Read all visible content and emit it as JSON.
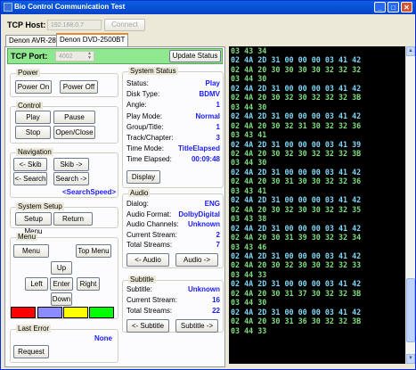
{
  "window": {
    "title": "Bio Control Communication Test",
    "min": "_",
    "max": "□",
    "close": "✕"
  },
  "tcp_host": {
    "label": "TCP Host:",
    "value": "192.168.0.7",
    "connect": "Connect"
  },
  "tabs": [
    "Denon AVR-2808",
    "Denon DVD-2500BT"
  ],
  "tcp_port": {
    "label": "TCP Port:",
    "value": "4002",
    "update": "Update Status"
  },
  "power": {
    "title": "Power",
    "on": "Power On",
    "off": "Power Off"
  },
  "control": {
    "title": "Control",
    "play": "Play",
    "pause": "Pause",
    "stop": "Stop",
    "open_close": "Open/Close"
  },
  "navigation": {
    "title": "Navigation",
    "skip_back": "<- Skib",
    "skip_fwd": "Skib ->",
    "search_back": "<- Search",
    "search_fwd": "Search ->",
    "search_speed": "<SearchSpeed>"
  },
  "system_setup": {
    "title": "System Setup",
    "setup_menu": "Setup Menu",
    "return": "Return"
  },
  "menu": {
    "title": "Menu",
    "menu": "Menu",
    "top_menu": "Top Menu",
    "up": "Up",
    "left": "Left",
    "enter": "Enter",
    "right": "Right",
    "down": "Down",
    "colors": [
      "#ff0000",
      "#8a8cff",
      "#ffff00",
      "#00ff00"
    ]
  },
  "last_error": {
    "title": "Last Error",
    "value": "None",
    "request": "Request"
  },
  "status": {
    "title": "System Status",
    "rows": [
      {
        "label": "Status:",
        "value": "Play"
      },
      {
        "label": "Disk Type:",
        "value": "BDMV"
      },
      {
        "label": "Angle:",
        "value": "1"
      },
      {
        "label": "Play Mode:",
        "value": "Normal"
      },
      {
        "label": "Group/Title:",
        "value": "1"
      },
      {
        "label": "Track/Chapter:",
        "value": "3"
      },
      {
        "label": "Time Mode:",
        "value": "TitleElapsed"
      },
      {
        "label": "Time Elapsed:",
        "value": "00:09:48"
      }
    ],
    "display": "Display"
  },
  "audio": {
    "title": "Audio",
    "rows": [
      {
        "label": "Dialog:",
        "value": "ENG"
      },
      {
        "label": "Audio Format:",
        "value": "DolbyDigital"
      },
      {
        "label": "Audio Channels:",
        "value": "Unknown"
      },
      {
        "label": "Current Stream:",
        "value": "2"
      },
      {
        "label": "Total Streams:",
        "value": "7"
      }
    ],
    "prev": "<- Audio",
    "next": "Audio ->"
  },
  "subtitle": {
    "title": "Subtitle",
    "rows": [
      {
        "label": "Subtitle:",
        "value": "Unknown"
      },
      {
        "label": "Current Stream:",
        "value": "16"
      },
      {
        "label": "Total Streams:",
        "value": "22"
      }
    ],
    "prev": "<- Subtitle",
    "next": "Subtitle ->"
  },
  "terminal": {
    "colors": {
      "rx": "#7fd7f5",
      "tx": "#7fdc7f"
    },
    "lines": [
      {
        "t": "03 43 34",
        "c": "tx"
      },
      {
        "t": "02 4A 2D 31 00 00 00 03 41 42",
        "c": "rx"
      },
      {
        "t": "02 4A 20 30 30 30 30 32 32 32",
        "c": "tx"
      },
      {
        "t": "03 44 30",
        "c": "tx"
      },
      {
        "t": "02 4A 2D 31 00 00 00 03 41 42",
        "c": "rx"
      },
      {
        "t": "02 4A 20 30 32 30 32 32 32 3B",
        "c": "tx"
      },
      {
        "t": "03 44 30",
        "c": "tx"
      },
      {
        "t": "02 4A 2D 31 00 00 00 03 41 42",
        "c": "rx"
      },
      {
        "t": "02 4A 20 30 32 31 30 32 32 36",
        "c": "tx"
      },
      {
        "t": "03 43 41",
        "c": "tx"
      },
      {
        "t": "02 4A 2D 31 00 00 00 03 41 39",
        "c": "rx"
      },
      {
        "t": "02 4A 20 30 32 30 32 32 32 3B",
        "c": "tx"
      },
      {
        "t": "03 44 30",
        "c": "tx"
      },
      {
        "t": "02 4A 2D 31 00 00 00 03 41 42",
        "c": "rx"
      },
      {
        "t": "02 4A 20 30 31 30 30 32 32 36",
        "c": "tx"
      },
      {
        "t": "03 43 41",
        "c": "tx"
      },
      {
        "t": "02 4A 2D 31 00 00 00 03 41 42",
        "c": "rx"
      },
      {
        "t": "02 4A 20 30 32 30 30 32 32 35",
        "c": "tx"
      },
      {
        "t": "03 43 38",
        "c": "tx"
      },
      {
        "t": "02 4A 2D 31 00 00 00 03 41 42",
        "c": "rx"
      },
      {
        "t": "02 4A 20 30 31 39 30 32 32 34",
        "c": "tx"
      },
      {
        "t": "03 43 46",
        "c": "tx"
      },
      {
        "t": "02 4A 2D 31 00 00 00 03 41 42",
        "c": "rx"
      },
      {
        "t": "02 4A 20 30 32 30 30 32 32 33",
        "c": "tx"
      },
      {
        "t": "03 44 33",
        "c": "tx"
      },
      {
        "t": "02 4A 2D 31 00 00 00 03 41 42",
        "c": "rx"
      },
      {
        "t": "02 4A 20 30 31 37 30 32 32 3B",
        "c": "tx"
      },
      {
        "t": "03 44 30",
        "c": "tx"
      },
      {
        "t": "02 4A 2D 31 00 00 00 03 41 42",
        "c": "rx"
      },
      {
        "t": "02 4A 20 30 31 36 30 32 32 3B",
        "c": "tx"
      },
      {
        "t": "03 44 33",
        "c": "tx"
      }
    ]
  }
}
